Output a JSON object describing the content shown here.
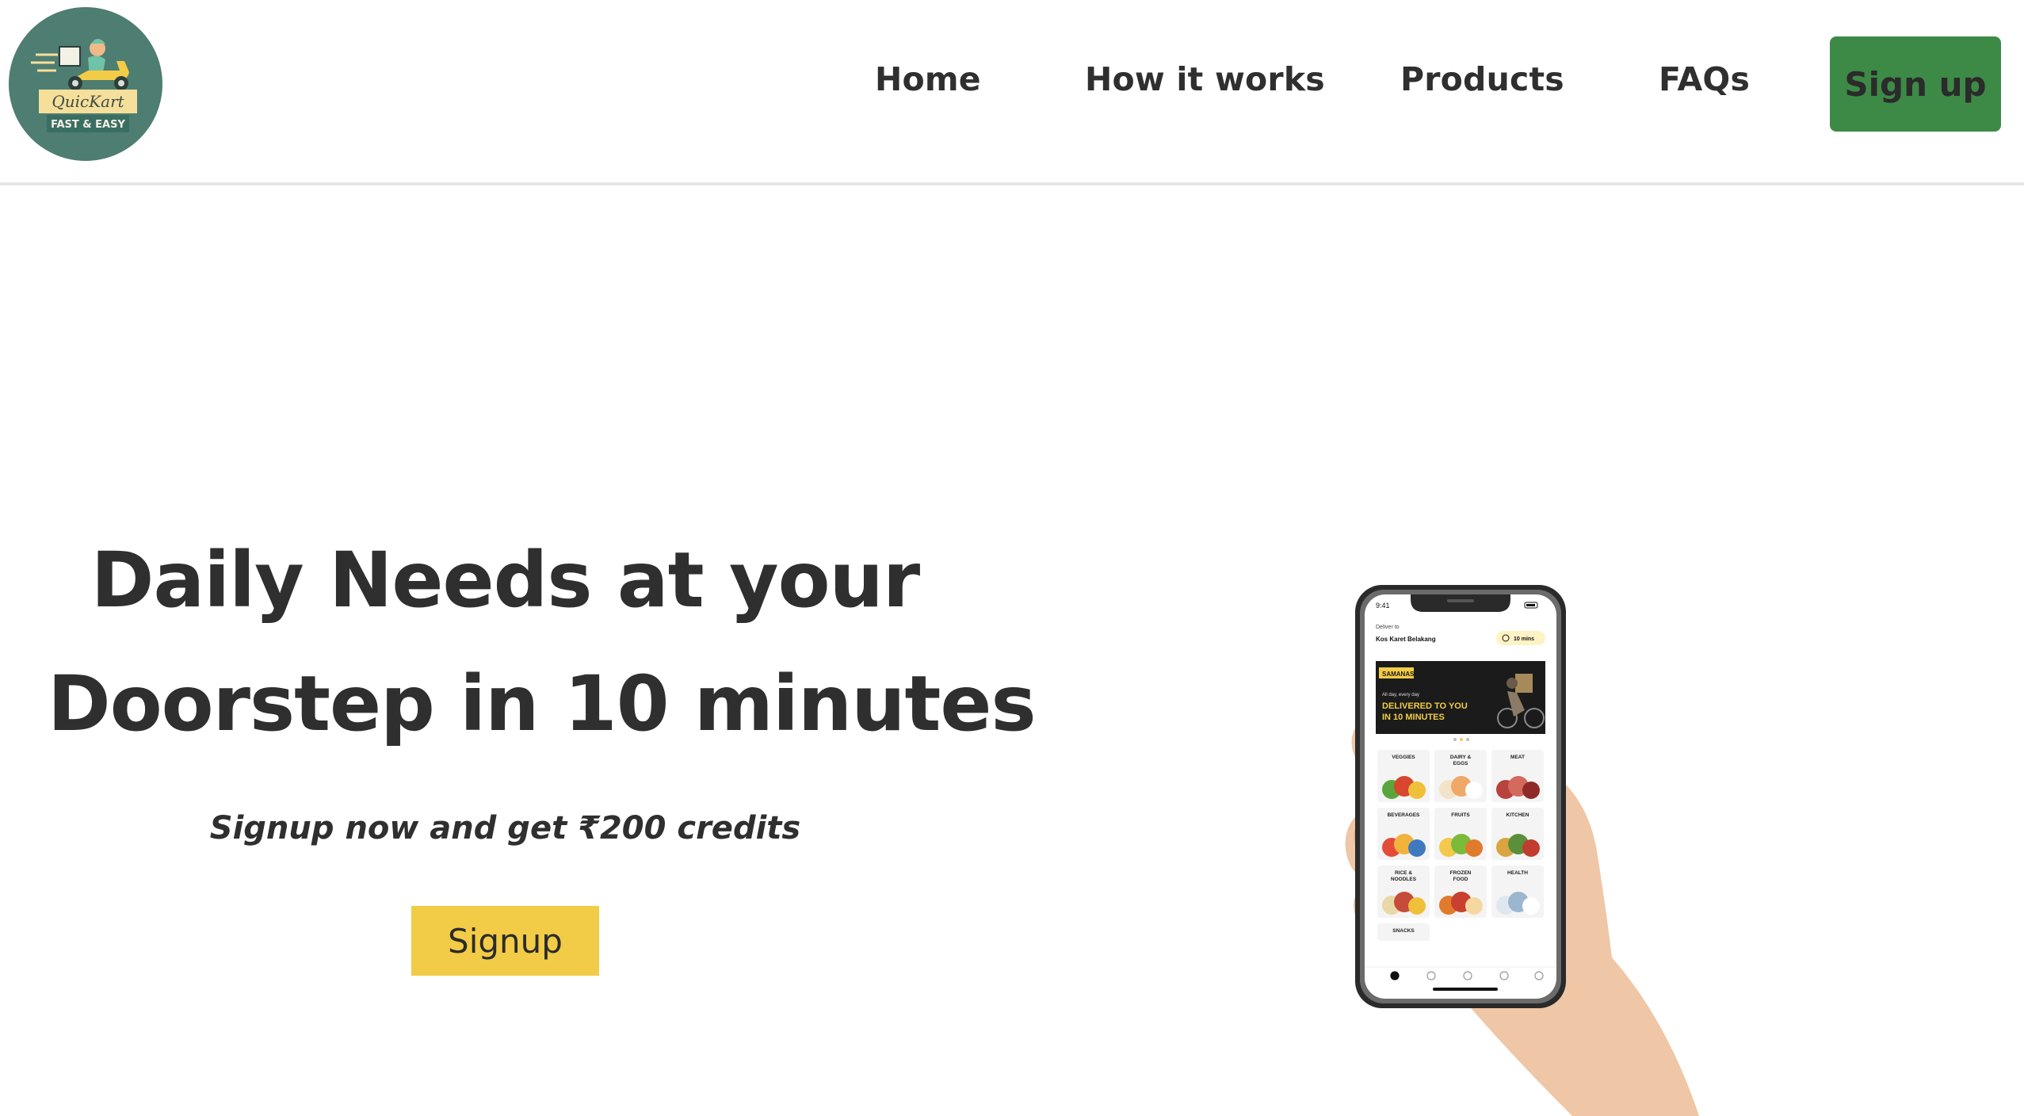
{
  "header": {
    "logo": {
      "brand_name": "QuicKart",
      "tagline": "FAST & EASY",
      "icon": "delivery-scooter-icon",
      "bg_color": "#4e7d72"
    },
    "nav": {
      "home": "Home",
      "how_it_works": "How it works",
      "products": "Products",
      "faqs": "FAQs"
    },
    "signup_button": {
      "label": "Sign up",
      "color": "#3d8a47"
    }
  },
  "hero": {
    "title_line1": "Daily Needs at your",
    "title_line2": "Doorstep in 10 minutes",
    "subtitle": "Signup now and get ₹200 credits",
    "cta": {
      "label": "Signup",
      "color": "#f2cc46"
    }
  },
  "phone_screen": {
    "time": "9:41",
    "deliver_to_label": "Deliver to",
    "address": "Kos Karet Belakang",
    "eta_badge": "10 mins",
    "banner": {
      "tag": "SAMANAS",
      "small_text": "All day, every day",
      "line1": "DELIVERED TO YOU",
      "line2": "IN 10 MINUTES"
    },
    "categories": [
      {
        "line1": "VEGGIES",
        "line2": ""
      },
      {
        "line1": "DAIRY &",
        "line2": "EGGS"
      },
      {
        "line1": "MEAT",
        "line2": ""
      },
      {
        "line1": "BEVERAGES",
        "line2": ""
      },
      {
        "line1": "FRUITS",
        "line2": ""
      },
      {
        "line1": "KITCHEN",
        "line2": ""
      },
      {
        "line1": "RICE &",
        "line2": "NOODLES"
      },
      {
        "line1": "FROZEN",
        "line2": "FOOD"
      },
      {
        "line1": "HEALTH",
        "line2": ""
      },
      {
        "line1": "SNACKS",
        "line2": ""
      }
    ],
    "tab_icons": [
      "home-icon",
      "search-icon",
      "cart-icon",
      "orders-icon",
      "profile-icon"
    ]
  }
}
